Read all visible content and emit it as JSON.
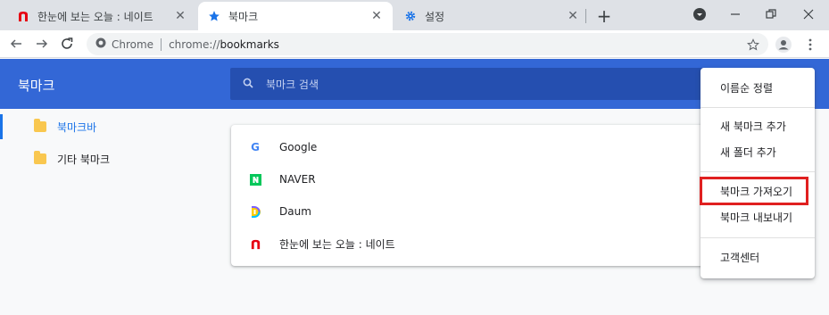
{
  "tabs": [
    {
      "title": "한눈에 보는 오늘 : 네이트",
      "icon": "nate-icon"
    },
    {
      "title": "북마크",
      "icon": "star-icon"
    },
    {
      "title": "설정",
      "icon": "gear-icon"
    }
  ],
  "toolbar": {
    "chrome_label": "Chrome",
    "url_scheme": "chrome://",
    "url_host": "bookmarks"
  },
  "header": {
    "title": "북마크",
    "search_placeholder": "북마크 검색"
  },
  "sidebar": {
    "items": [
      {
        "label": "북마크바",
        "selected": true
      },
      {
        "label": "기타 북마크",
        "selected": false
      }
    ]
  },
  "bookmarks": [
    {
      "label": "Google",
      "icon": "google-icon"
    },
    {
      "label": "NAVER",
      "icon": "naver-icon"
    },
    {
      "label": "Daum",
      "icon": "daum-icon"
    },
    {
      "label": "한눈에 보는 오늘 : 네이트",
      "icon": "nate-icon"
    }
  ],
  "menu": {
    "items": [
      {
        "label": "이름순 정렬"
      },
      {
        "label": "새 북마크 추가"
      },
      {
        "label": "새 폴더 추가"
      },
      {
        "label": "북마크 가져오기",
        "highlighted": true
      },
      {
        "label": "북마크 내보내기"
      },
      {
        "label": "고객센터"
      }
    ]
  },
  "colors": {
    "header_blue": "#3367d6",
    "search_blue": "#254fb0",
    "highlight_red": "#e02020",
    "selected_blue": "#1a73e8"
  }
}
